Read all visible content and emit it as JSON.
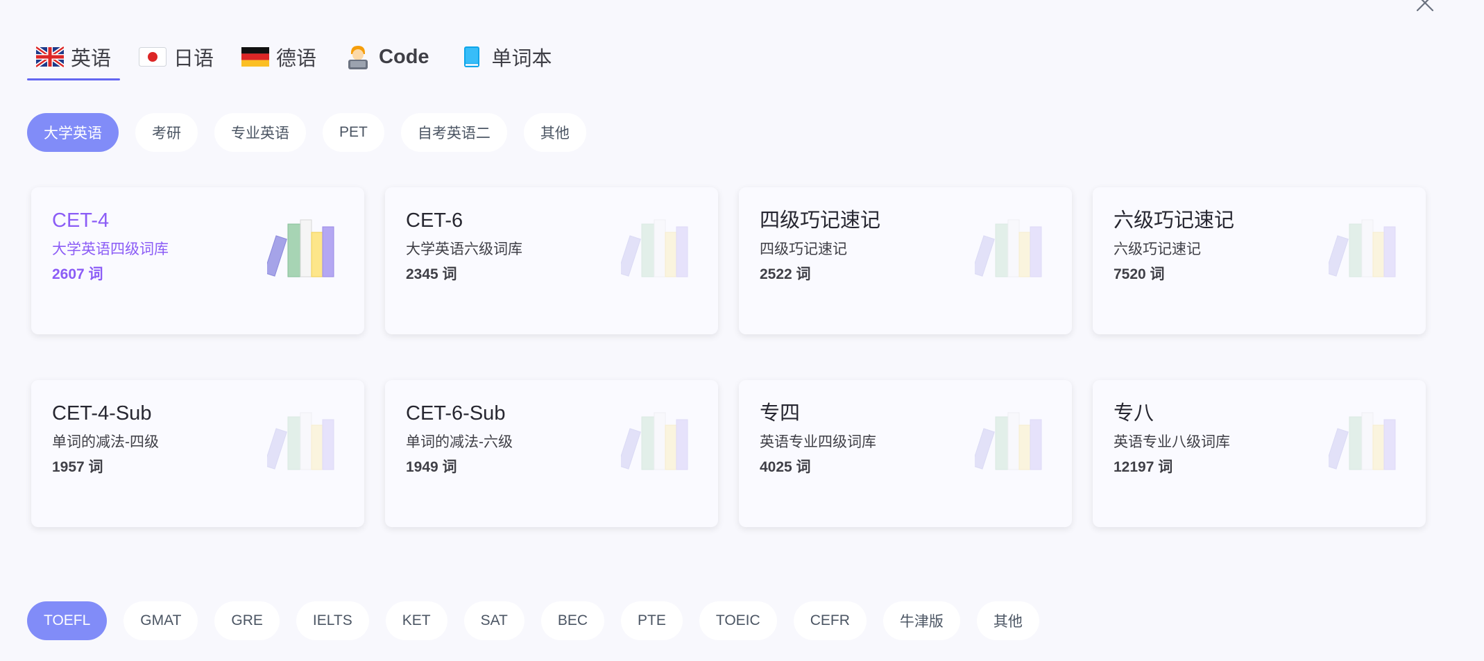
{
  "header": {
    "close_icon": "close-icon"
  },
  "lang_tabs": [
    {
      "label": "英语",
      "icon": "uk-flag-icon",
      "active": true
    },
    {
      "label": "日语",
      "icon": "japan-flag-icon",
      "active": false
    },
    {
      "label": "德语",
      "icon": "germany-flag-icon",
      "active": false
    },
    {
      "label": "Code",
      "icon": "coder-icon",
      "active": false
    },
    {
      "label": "单词本",
      "icon": "blue-book-icon",
      "active": false
    }
  ],
  "category_group_1": [
    "大学英语",
    "考研",
    "专业英语",
    "PET",
    "自考英语二",
    "其他"
  ],
  "category_group_1_active": "大学英语",
  "cards": [
    {
      "title": "CET-4",
      "desc": "大学英语四级词库",
      "count": "2607 词",
      "selected": true
    },
    {
      "title": "CET-6",
      "desc": "大学英语六级词库",
      "count": "2345 词",
      "selected": false
    },
    {
      "title": "四级巧记速记",
      "desc": "四级巧记速记",
      "count": "2522 词",
      "selected": false
    },
    {
      "title": "六级巧记速记",
      "desc": "六级巧记速记",
      "count": "7520 词",
      "selected": false
    },
    {
      "title": "CET-4-Sub",
      "desc": "单词的减法-四级",
      "count": "1957 词",
      "selected": false
    },
    {
      "title": "CET-6-Sub",
      "desc": "单词的减法-六级",
      "count": "1949 词",
      "selected": false
    },
    {
      "title": "专四",
      "desc": "英语专业四级词库",
      "count": "4025 词",
      "selected": false
    },
    {
      "title": "专八",
      "desc": "英语专业八级词库",
      "count": "12197 词",
      "selected": false
    }
  ],
  "category_group_2": [
    "TOEFL",
    "GMAT",
    "GRE",
    "IELTS",
    "KET",
    "SAT",
    "BEC",
    "PTE",
    "TOEIC",
    "CEFR",
    "牛津版",
    "其他"
  ],
  "category_group_2_active": "TOEFL",
  "colors": {
    "accent": "#818cf8",
    "tab_underline": "#6366f1",
    "selected_card_text": "#8b5cf6",
    "background": "#f8f8fd"
  }
}
